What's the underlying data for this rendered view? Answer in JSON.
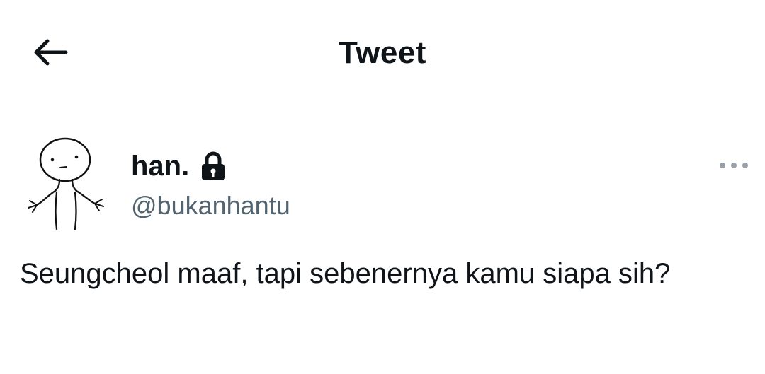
{
  "header": {
    "title": "Tweet",
    "back_icon": "arrow-left-icon"
  },
  "tweet": {
    "display_name": "han.",
    "protected_icon": "lock-icon",
    "handle": "@bukanhantu",
    "more_icon": "more-horizontal-icon",
    "text": "Seungcheol maaf, tapi sebenernya kamu siapa sih?"
  }
}
